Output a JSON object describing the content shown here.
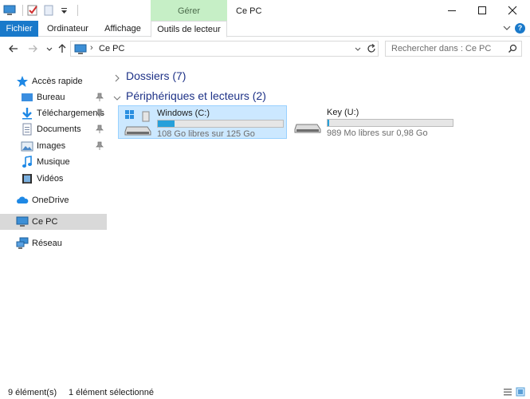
{
  "window": {
    "title": "Ce PC",
    "contextual_tab": "Gérer"
  },
  "ribbon": {
    "tabs": [
      {
        "label": "Fichier"
      },
      {
        "label": "Ordinateur"
      },
      {
        "label": "Affichage"
      },
      {
        "label": "Outils de lecteur"
      }
    ]
  },
  "address": {
    "crumb": "Ce PC",
    "search_placeholder": "Rechercher dans : Ce PC"
  },
  "nav": {
    "quick_access": "Accès rapide",
    "items": [
      {
        "label": "Bureau",
        "icon": "desktop-icon",
        "pinned": true
      },
      {
        "label": "Téléchargements",
        "icon": "downloads-icon",
        "pinned": true
      },
      {
        "label": "Documents",
        "icon": "documents-icon",
        "pinned": true
      },
      {
        "label": "Images",
        "icon": "images-icon",
        "pinned": true
      },
      {
        "label": "Musique",
        "icon": "music-icon",
        "pinned": false
      },
      {
        "label": "Vidéos",
        "icon": "videos-icon",
        "pinned": false
      }
    ],
    "onedrive": "OneDrive",
    "this_pc": "Ce PC",
    "network": "Réseau"
  },
  "content": {
    "folders_header": "Dossiers (7)",
    "devices_header": "Périphériques et lecteurs (2)",
    "drives": [
      {
        "name": "Windows (C:)",
        "info": "108 Go libres sur 125 Go",
        "used_fraction": 0.136,
        "selected": true
      },
      {
        "name": "Key (U:)",
        "info": "989 Mo libres sur 0,98 Go",
        "used_fraction": 0.015,
        "selected": false
      }
    ]
  },
  "status": {
    "count": "9 élément(s)",
    "selection": "1 élément sélectionné"
  },
  "colors": {
    "accent": "#1979ca",
    "manage_tab": "#c6efc6",
    "selection": "#cce8ff",
    "bar_fill": "#26a0da",
    "group_header": "#1e3287"
  }
}
